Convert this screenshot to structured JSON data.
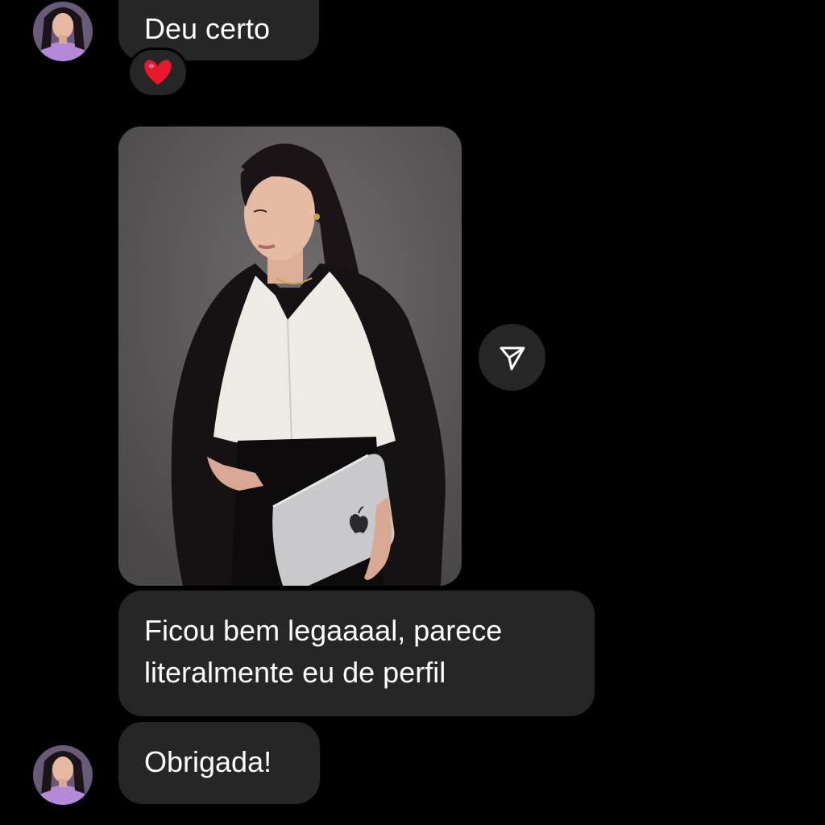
{
  "messages": [
    {
      "sender": "contact",
      "text": "Deu certo"
    },
    {
      "sender": "contact",
      "type": "image"
    },
    {
      "sender": "contact",
      "text": "Ficou bem legaaaal, parece literalmente eu de perfil"
    },
    {
      "sender": "contact",
      "text": "Obrigada!"
    }
  ],
  "reaction": {
    "emoji": "heart-icon",
    "color": "#e8192c"
  },
  "colors": {
    "background": "#000000",
    "bubble": "#262626",
    "text": "#ffffff"
  }
}
